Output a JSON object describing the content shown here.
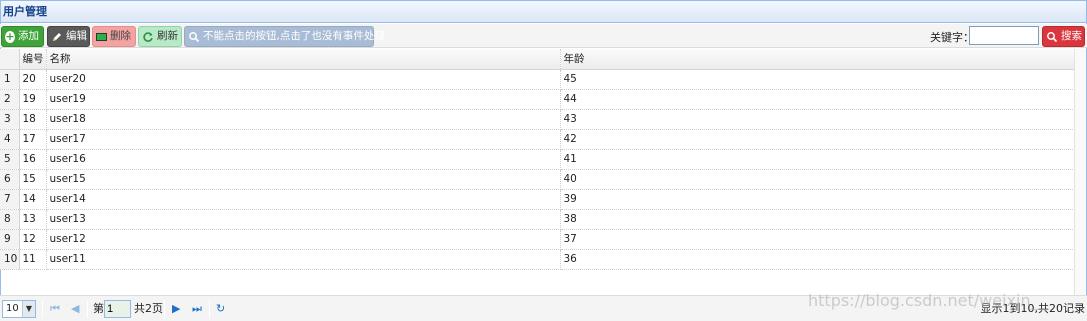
{
  "panel": {
    "title": "用户管理"
  },
  "toolbar": {
    "add_label": "添加",
    "edit_label": "编辑",
    "delete_label": "删除",
    "refresh_label": "刷新",
    "disabled_label": "不能点击的按钮,点击了也没有事件处理",
    "keyword_label": "关键字：",
    "keyword_value": "",
    "search_label": "搜索"
  },
  "table": {
    "columns": [
      "编号",
      "名称",
      "年龄"
    ],
    "rows": [
      {
        "n": "1",
        "id": "20",
        "name": "user20",
        "age": "45"
      },
      {
        "n": "2",
        "id": "19",
        "name": "user19",
        "age": "44"
      },
      {
        "n": "3",
        "id": "18",
        "name": "user18",
        "age": "43"
      },
      {
        "n": "4",
        "id": "17",
        "name": "user17",
        "age": "42"
      },
      {
        "n": "5",
        "id": "16",
        "name": "user16",
        "age": "41"
      },
      {
        "n": "6",
        "id": "15",
        "name": "user15",
        "age": "40"
      },
      {
        "n": "7",
        "id": "14",
        "name": "user14",
        "age": "39"
      },
      {
        "n": "8",
        "id": "13",
        "name": "user13",
        "age": "38"
      },
      {
        "n": "9",
        "id": "12",
        "name": "user12",
        "age": "37"
      },
      {
        "n": "10",
        "id": "11",
        "name": "user11",
        "age": "36"
      }
    ]
  },
  "pager": {
    "page_size": "10",
    "page_prefix": "第",
    "page_number": "1",
    "page_total": "共2页",
    "info": "显示1到10,共20记录"
  },
  "watermark": "https://blog.csdn.net/weixin_",
  "colors": {
    "add": "#3ea43a",
    "edit": "#5a5a5a",
    "delete": "#f4a3a3",
    "refresh": "#b9eac7",
    "disabled": "#a9bcd6",
    "search": "#d9363e",
    "header_border": "#99bbe8"
  }
}
